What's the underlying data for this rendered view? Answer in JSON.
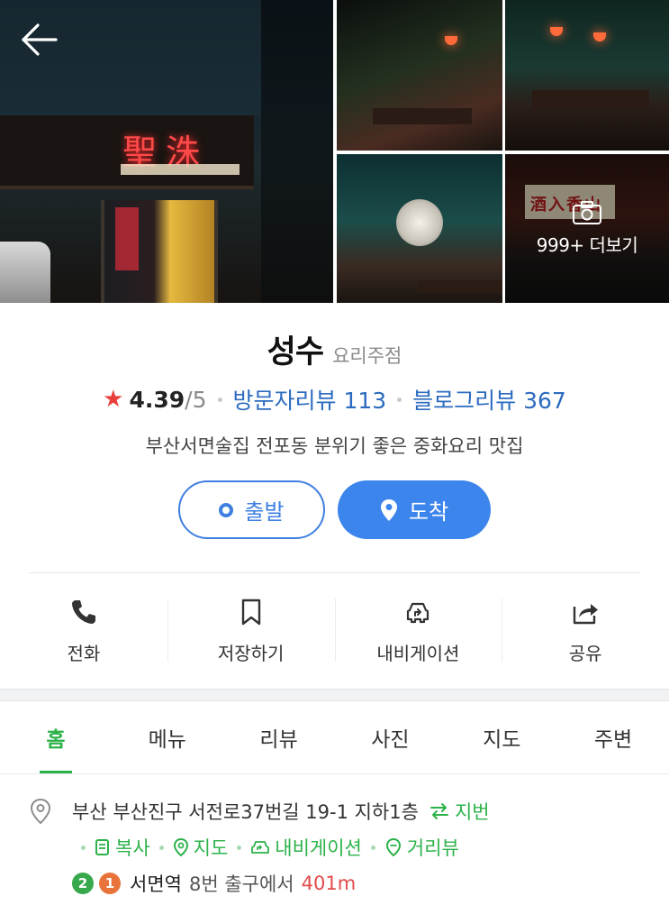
{
  "photos": {
    "more_text": "999+ 더보기",
    "sign_text": "聖洙",
    "sign_board_text": "酒入香山"
  },
  "place": {
    "name": "성수",
    "category": "요리주점",
    "rating": "4.39",
    "rating_max": "/5",
    "visitor_reviews": "방문자리뷰 113",
    "blog_reviews": "블로그리뷰 367",
    "description": "부산서면술집 전포동 분위기 좋은 중화요리 맛집"
  },
  "buttons": {
    "start": "출발",
    "arrive": "도착"
  },
  "actions": [
    {
      "label": "전화",
      "icon": "phone-icon"
    },
    {
      "label": "저장하기",
      "icon": "bookmark-icon"
    },
    {
      "label": "내비게이션",
      "icon": "navigation-icon"
    },
    {
      "label": "공유",
      "icon": "share-icon"
    }
  ],
  "tabs": [
    "홈",
    "메뉴",
    "리뷰",
    "사진",
    "지도",
    "주변"
  ],
  "active_tab": "홈",
  "info": {
    "address": "부산 부산진구 서전로37번길 19-1 지하1층",
    "jibun": "지번",
    "copy": "복사",
    "map": "지도",
    "navigation": "내비게이션",
    "street_view": "거리뷰",
    "line_badges": [
      {
        "text": "2",
        "color": "#37a94c"
      },
      {
        "text": "1",
        "color": "#e8743b"
      }
    ],
    "station": "서면역",
    "exit": "8번 출구에서",
    "distance": "401m"
  },
  "colors": {
    "accent_green": "#2db24a",
    "accent_blue": "#3c85ec",
    "star_red": "#e9403b",
    "link_blue": "#2c6bbf"
  }
}
